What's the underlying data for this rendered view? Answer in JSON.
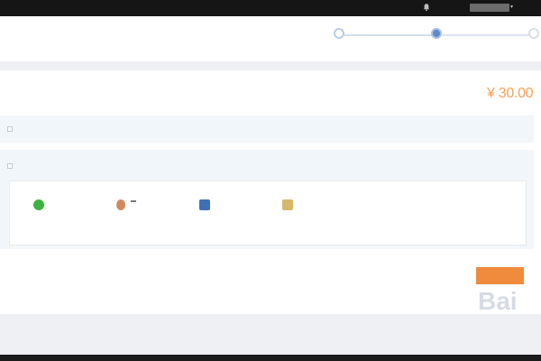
{
  "topbar": {
    "brand": "",
    "message_label": "",
    "username": "",
    "more_label": ""
  },
  "header": {
    "title": "",
    "steps": [
      {
        "label": "",
        "state": "done"
      },
      {
        "label": "",
        "state": "active"
      },
      {
        "label": "",
        "state": "pending"
      }
    ]
  },
  "order": {
    "info": "",
    "amount_label": "",
    "amount": "¥ 30.00"
  },
  "balance": {
    "label": "",
    "hint": ""
  },
  "third_party": {
    "label": "",
    "description": "",
    "pay_label": "",
    "pay_amount": ""
  },
  "payment_methods": [
    {
      "name": "",
      "icon": "wechat-pay-icon"
    },
    {
      "name": "",
      "icon": "qq-wallet-icon"
    },
    {
      "name": "",
      "icon": "bank-card-icon"
    },
    {
      "name": "",
      "icon": "credit-card-icon"
    }
  ],
  "notes": {
    "line1": "",
    "line1_link": "",
    "line2": "",
    "line2_warn": ""
  },
  "actions": {
    "next_label": ""
  },
  "watermark": {
    "text": "Bai",
    "sub": ""
  },
  "colors": {
    "accent": "#f08a3c",
    "amount": "#f7a15a",
    "step_active": "#5f8ac9",
    "wechat": "#3db33d",
    "bank": "#3f6fb4"
  }
}
